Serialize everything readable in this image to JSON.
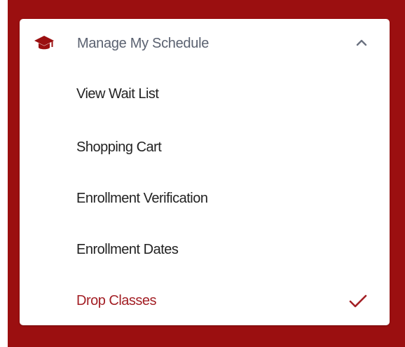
{
  "colors": {
    "brand": "#9b0f10",
    "active_text": "#a31f25",
    "header_text": "#5a6170",
    "item_text": "#222222"
  },
  "menu": {
    "header": {
      "icon": "graduation-cap-icon",
      "title": "Manage My Schedule",
      "expand_icon": "chevron-up-icon",
      "expanded": true
    },
    "items": [
      {
        "label": "View Wait List",
        "active": false
      },
      {
        "label": "Shopping Cart",
        "active": false
      },
      {
        "label": "Enrollment Verification",
        "active": false
      },
      {
        "label": "Enrollment Dates",
        "active": false
      },
      {
        "label": "Drop Classes",
        "active": true,
        "icon": "checkmark-icon"
      }
    ]
  }
}
